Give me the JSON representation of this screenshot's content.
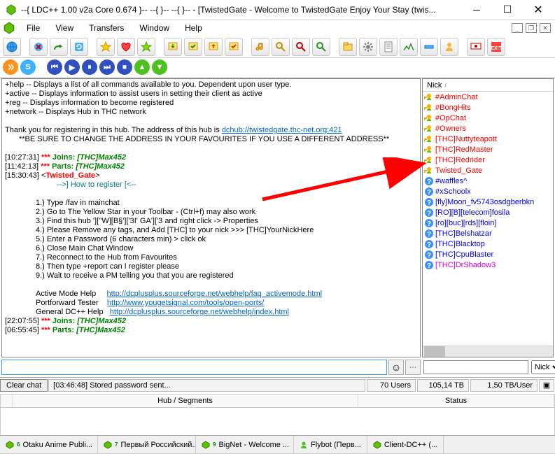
{
  "title": "--{ LDC++ 1.00 v2a Core 0.674 }--  --{  }--  --{         }-- - [TwistedGate - Welcome to TwistedGate Enjoy Your Stay (twis...",
  "menu": [
    "File",
    "View",
    "Transfers",
    "Window",
    "Help"
  ],
  "chat": {
    "l1": "+help          -- Displays a list of all commands available to you. Dependent upon user type.",
    "l2": "+active       -- Displays information to assist users in setting their client as active",
    "l3": "+reg          -- Displays information to become registered",
    "l4": "+network     -- Displays Hub in THC network",
    "l5_a": "Thank you for registering in this hub. The address of this hub is ",
    "l5_link": "dchub://twistedgate.thc-net.org:421",
    "l6": "**BE SURE TO CHANGE THE ADDRESS IN YOUR FAVOURITES IF YOU USE A DIFFERENT ADDRESS**",
    "e1_ts": "[10:27:31]",
    "e1_kind": "Joins:",
    "e1_nick": "[THC]Max452",
    "e2_ts": "[11:42:13]",
    "e2_kind": "Parts:",
    "e2_nick": "[THC]Max452",
    "e3_ts": "[15:30:43]",
    "e3_nick": "Twisted_Gate",
    "e3_sub": "-->] How to register [<--",
    "s1": "1.) Type /fav in mainchat",
    "s2": "2.) Go to The Yellow Star in your Toolbar - (Ctrl+f) may also work",
    "s3": "3.) Find this hub '][''W][B§']['3I' GA']['3 and right click -> Properties",
    "s4": "4.) Please Remove any tags, and Add  [THC]  to your nick  >>>  [THC]YourNickHere",
    "s5": "5.) Enter a Password (6 characters min) > click ok",
    "s6": "6.) Close Main Chat Window",
    "s7": "7.) Reconnect to the Hub from Favourites",
    "s8": "8.) Then type +report can I register please",
    "s9": "9.) Wait to receive a PM telling you that you are registered",
    "h1_label": "Active Mode Help",
    "h1_link": "http://dcplusplus.sourceforge.net/webhelp/faq_activemode.html",
    "h2_label": "Portforward Tester",
    "h2_link": "http://www.yougetsignal.com/tools/open-ports/",
    "h3_label": "General DC++ Help",
    "h3_link": "http://dcplusplus.sourceforge.net/webhelp/index.html",
    "e4_ts": "[22:07:55]",
    "e4_kind": "Joins:",
    "e4_nick": "[THC]Max452",
    "e5_ts": "[06:55:45]",
    "e5_kind": "Parts:",
    "e5_nick": "[THC]Max452"
  },
  "nick_header": "Nick",
  "users": [
    {
      "name": "#AdminChat",
      "color": "red",
      "icon": "key"
    },
    {
      "name": "#BongHits",
      "color": "red",
      "icon": "key"
    },
    {
      "name": "#OpChat",
      "color": "red",
      "icon": "key"
    },
    {
      "name": "#Owners",
      "color": "red",
      "icon": "key"
    },
    {
      "name": "[THC]Nuttyteapott",
      "color": "red",
      "icon": "key"
    },
    {
      "name": "[THC]RedMaster",
      "color": "red",
      "icon": "key"
    },
    {
      "name": "[THC]Redrider",
      "color": "red",
      "icon": "key"
    },
    {
      "name": "Twisted_Gate",
      "color": "red",
      "icon": "key"
    },
    {
      "name": "#waffles^",
      "color": "blue",
      "icon": "q"
    },
    {
      "name": "#xSchoolx",
      "color": "blue",
      "icon": "q"
    },
    {
      "name": "[fly]Moon_fv5743osdgberbkn",
      "color": "blue",
      "icon": "q"
    },
    {
      "name": "[RO][B][telecom]fosila",
      "color": "blue",
      "icon": "q"
    },
    {
      "name": "[ro][buc][rds][floin]",
      "color": "blue",
      "icon": "q"
    },
    {
      "name": "[THC]Belshatzar",
      "color": "blue",
      "icon": "q"
    },
    {
      "name": "[THC]Blacktop",
      "color": "blue",
      "icon": "q"
    },
    {
      "name": "[THC]CpuBlaster",
      "color": "blue",
      "icon": "q"
    },
    {
      "name": "[THC]DrShadow3",
      "color": "magenta",
      "icon": "q"
    }
  ],
  "controls": {
    "clear": "Clear chat",
    "stored": "[03:46:48] Stored password sent...",
    "users_count": "70 Users",
    "total": "105,14 TB",
    "per_user": "1,50 TB/User",
    "nick_filter": "Nick"
  },
  "cols": {
    "hub": "Hub / Segments",
    "status": "Status"
  },
  "tabs": [
    {
      "label": "Otaku Anime Publi...",
      "color": "#2faa2f"
    },
    {
      "label": "Первый Российский...",
      "color": "#2faa2f"
    },
    {
      "label": "BigNet - Welcome ...",
      "color": "#2faa2f"
    },
    {
      "label": "Flybot       (Перв...",
      "color": "#2faa2f",
      "user": true
    },
    {
      "label": "Client-DC++   (...",
      "color": "#2faa2f"
    }
  ]
}
